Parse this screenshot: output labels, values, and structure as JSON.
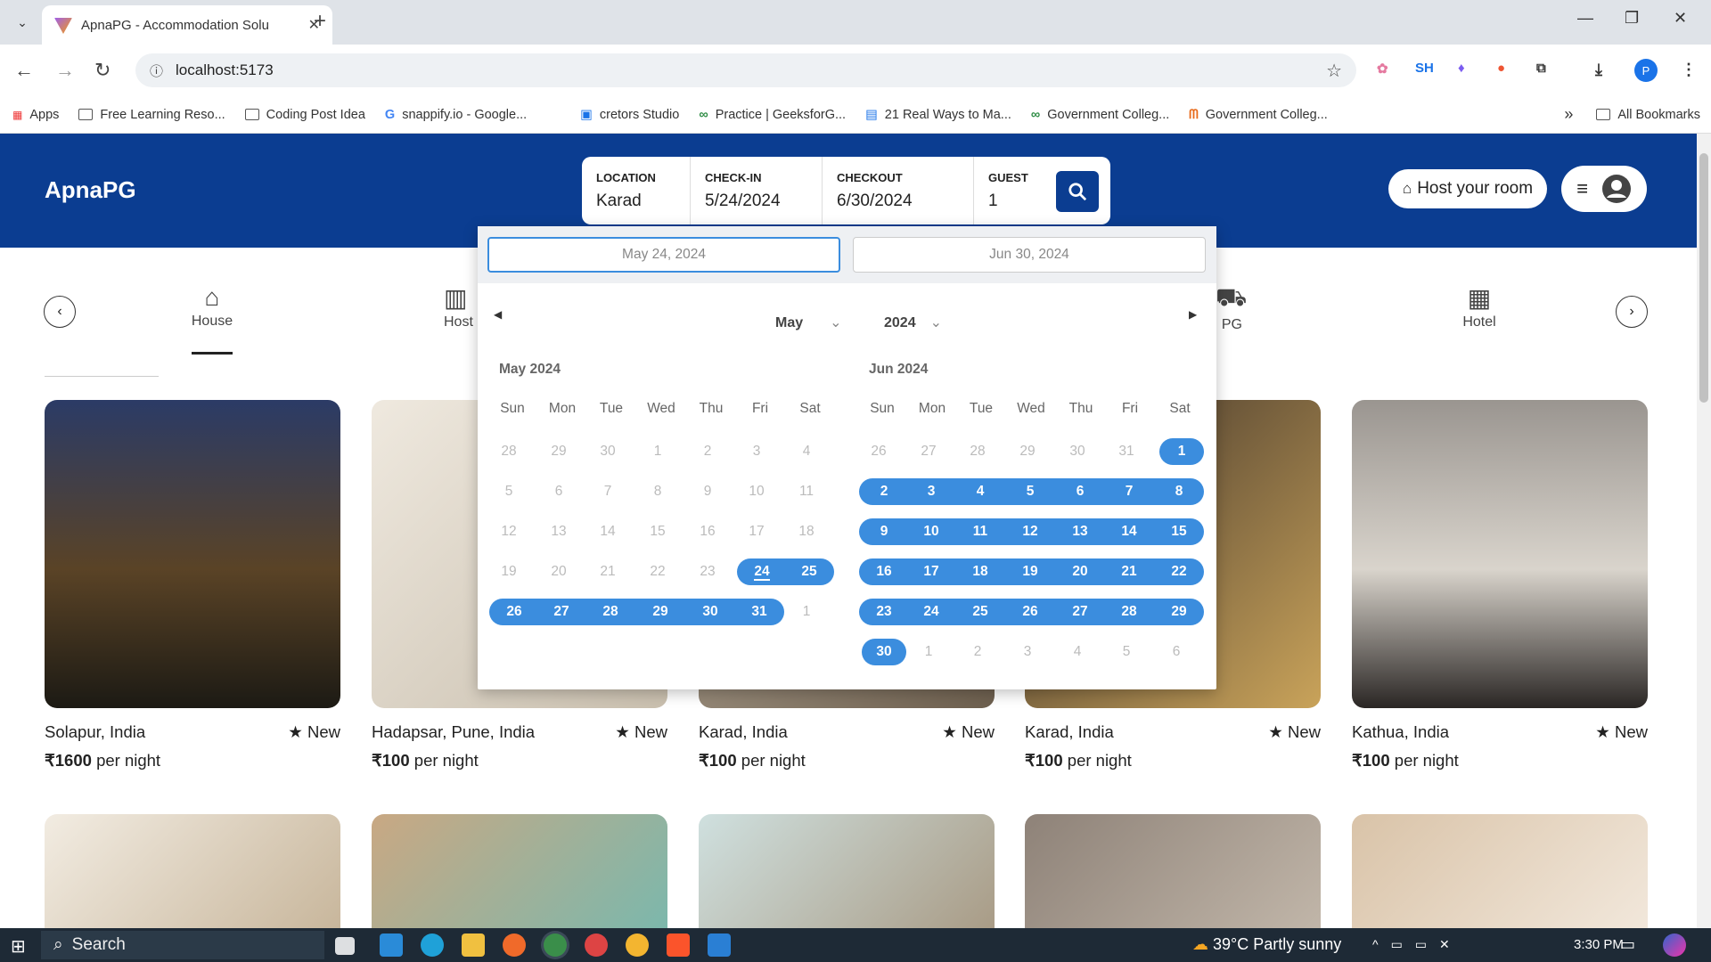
{
  "browser": {
    "tab_title": "ApnaPG - Accommodation Solu",
    "url": "localhost:5173",
    "profile_initial": "P",
    "extension_text": "SH",
    "bookmarks": [
      "Apps",
      "Free Learning Reso...",
      "Coding Post Idea",
      "snappify.io - Google...",
      "cretors Studio",
      "Practice | GeeksforG...",
      "21 Real Ways to Ma...",
      "Government Colleg...",
      "Government Colleg..."
    ],
    "all_bookmarks": "All Bookmarks"
  },
  "header": {
    "logo": "ApnaPG",
    "location_label": "LOCATION",
    "location_value": "Karad",
    "checkin_label": "CHECK-IN",
    "checkin_value": "5/24/2024",
    "checkout_label": "CHECKOUT",
    "checkout_value": "6/30/2024",
    "guest_label": "GUEST",
    "guest_value": "1",
    "host_button": "Host your room"
  },
  "categories": {
    "items": [
      {
        "label": "House",
        "icon": "house-icon"
      },
      {
        "label": "Host",
        "icon": "building-icon"
      },
      {
        "label": "PG",
        "icon": "bus-icon"
      },
      {
        "label": "Hotel",
        "icon": "hotel-icon"
      }
    ]
  },
  "calendar": {
    "start_input": "May 24, 2024",
    "end_input": "Jun 30, 2024",
    "month_select": "May",
    "year_select": "2024",
    "weekdays": [
      "Sun",
      "Mon",
      "Tue",
      "Wed",
      "Thu",
      "Fri",
      "Sat"
    ],
    "months": [
      {
        "title": "May 2024",
        "weeks": [
          [
            "28",
            "29",
            "30",
            "1",
            "2",
            "3",
            "4"
          ],
          [
            "5",
            "6",
            "7",
            "8",
            "9",
            "10",
            "11"
          ],
          [
            "12",
            "13",
            "14",
            "15",
            "16",
            "17",
            "18"
          ],
          [
            "19",
            "20",
            "21",
            "22",
            "23",
            "24",
            "25"
          ],
          [
            "26",
            "27",
            "28",
            "29",
            "30",
            "31",
            "1"
          ]
        ]
      },
      {
        "title": "Jun 2024",
        "weeks": [
          [
            "26",
            "27",
            "28",
            "29",
            "30",
            "31",
            "1"
          ],
          [
            "2",
            "3",
            "4",
            "5",
            "6",
            "7",
            "8"
          ],
          [
            "9",
            "10",
            "11",
            "12",
            "13",
            "14",
            "15"
          ],
          [
            "16",
            "17",
            "18",
            "19",
            "20",
            "21",
            "22"
          ],
          [
            "23",
            "24",
            "25",
            "26",
            "27",
            "28",
            "29"
          ],
          [
            "30",
            "1",
            "2",
            "3",
            "4",
            "5",
            "6"
          ]
        ]
      }
    ]
  },
  "listings": [
    {
      "location": "Solapur, India",
      "badge": "New",
      "price": "₹1600",
      "suffix": "per night",
      "color": "#3a2a1a"
    },
    {
      "location": "Hadapsar, Pune, India",
      "badge": "New",
      "price": "₹100",
      "suffix": "per night",
      "color": "#d8d2c6"
    },
    {
      "location": "Karad, India",
      "badge": "New",
      "price": "₹100",
      "suffix": "per night",
      "color": "#8a7a66"
    },
    {
      "location": "Karad, India",
      "badge": "New",
      "price": "₹100",
      "suffix": "per night",
      "color": "#4a3a2e"
    },
    {
      "location": "Kathua, India",
      "badge": "New",
      "price": "₹100",
      "suffix": "per night",
      "color": "#8c8782"
    }
  ],
  "taskbar": {
    "search": "Search",
    "weather": "39°C  Partly sunny",
    "time": "3:30 PM"
  }
}
